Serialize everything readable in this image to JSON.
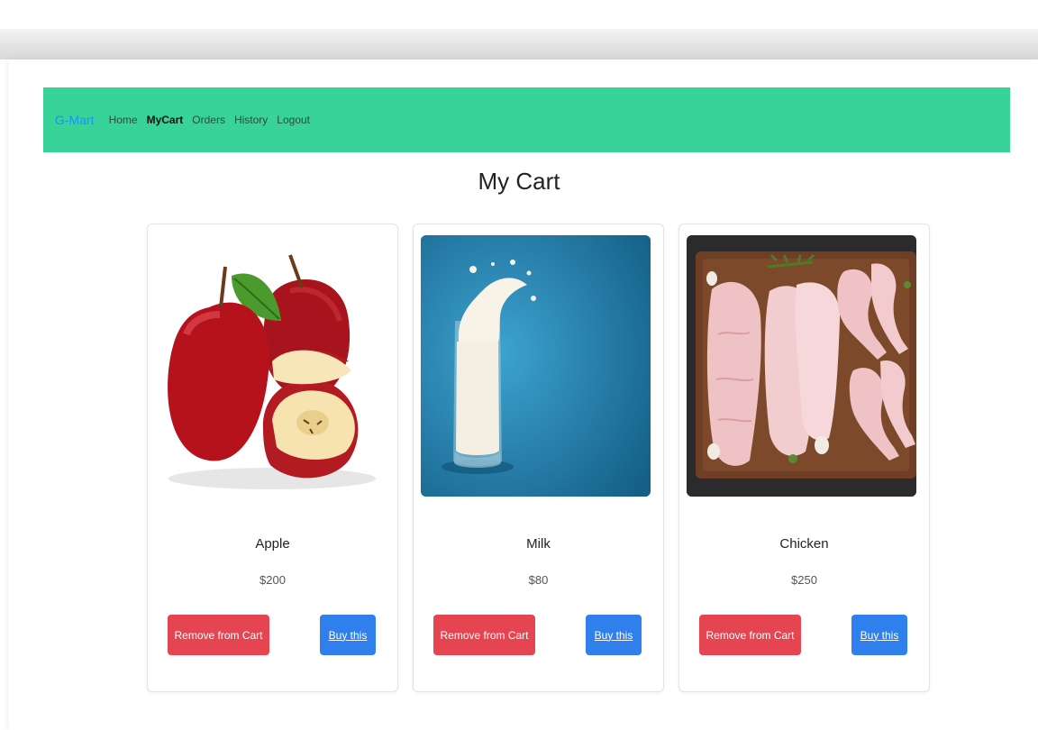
{
  "navbar": {
    "brand": "G-Mart",
    "links": [
      {
        "label": "Home"
      },
      {
        "label": "MyCart"
      },
      {
        "label": "Orders"
      },
      {
        "label": "History"
      },
      {
        "label": "Logout"
      }
    ],
    "active": "MyCart",
    "background": "#37d398",
    "brand_color": "#1e8fff"
  },
  "page": {
    "title": "My Cart"
  },
  "products": [
    {
      "name": "Apple",
      "price": "$200",
      "image": "apple-image",
      "remove_label": "Remove from Cart",
      "buy_label": "Buy this"
    },
    {
      "name": "Milk",
      "price": "$80",
      "image": "milk-image",
      "remove_label": "Remove from Cart",
      "buy_label": "Buy this"
    },
    {
      "name": "Chicken",
      "price": "$250",
      "image": "chicken-image",
      "remove_label": "Remove from Cart",
      "buy_label": "Buy this"
    }
  ],
  "colors": {
    "remove_button": "#e44550",
    "buy_button": "#2f80ed"
  }
}
